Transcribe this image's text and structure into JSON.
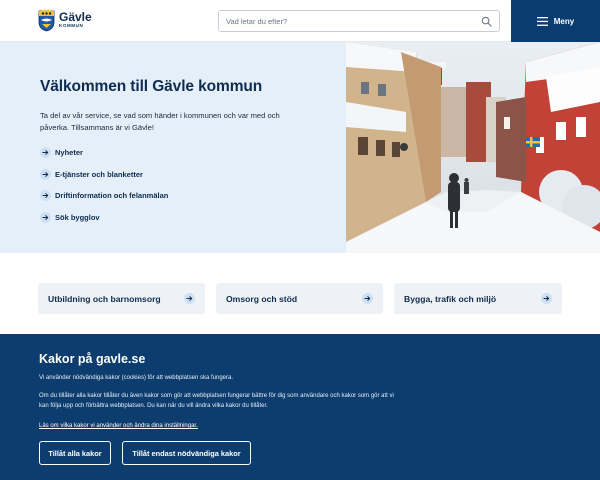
{
  "header": {
    "logo_name": "Gävle",
    "logo_sub": "KOMMUN",
    "search_placeholder": "Vad letar du efter?",
    "menu_label": "Meny"
  },
  "hero": {
    "title": "Välkommen till Gävle kommun",
    "lead": "Ta del av vår service, se vad som händer i kommunen och var med och påverka. Tillsammans är vi Gävle!",
    "links": [
      "Nyheter",
      "E-tjänster och blanketter",
      "Driftinformation och felanmälan",
      "Sök bygglov"
    ],
    "image_icon": "snowy-street-photo"
  },
  "categories": [
    "Utbildning och barnomsorg",
    "Omsorg och stöd",
    "Bygga, trafik och miljö"
  ],
  "cookie": {
    "title": "Kakor på gavle.se",
    "p1": "Vi använder nödvändiga kakor (cookies) för att webbplatsen ska fungera.",
    "p2": "Om du tillåter alla kakor tillåter du även kakor som gör att webbplatsen fungerar bättre för dig som användare och kakor som gör att vi kan följa upp och förbättra webbplatsen. Du kan när du vill ändra vilka kakor du tillåter.",
    "link": "Läs om vilka kakor vi använder och ändra dina inställningar.",
    "accept_all": "Tillåt alla kakor",
    "accept_necessary": "Tillåt endast nödvändiga kakor"
  },
  "colors": {
    "brand_dark": "#0b3c70",
    "hero_bg": "#e4effa",
    "card_bg": "#eef2f6",
    "cookie_bg": "#0d3d6e"
  }
}
